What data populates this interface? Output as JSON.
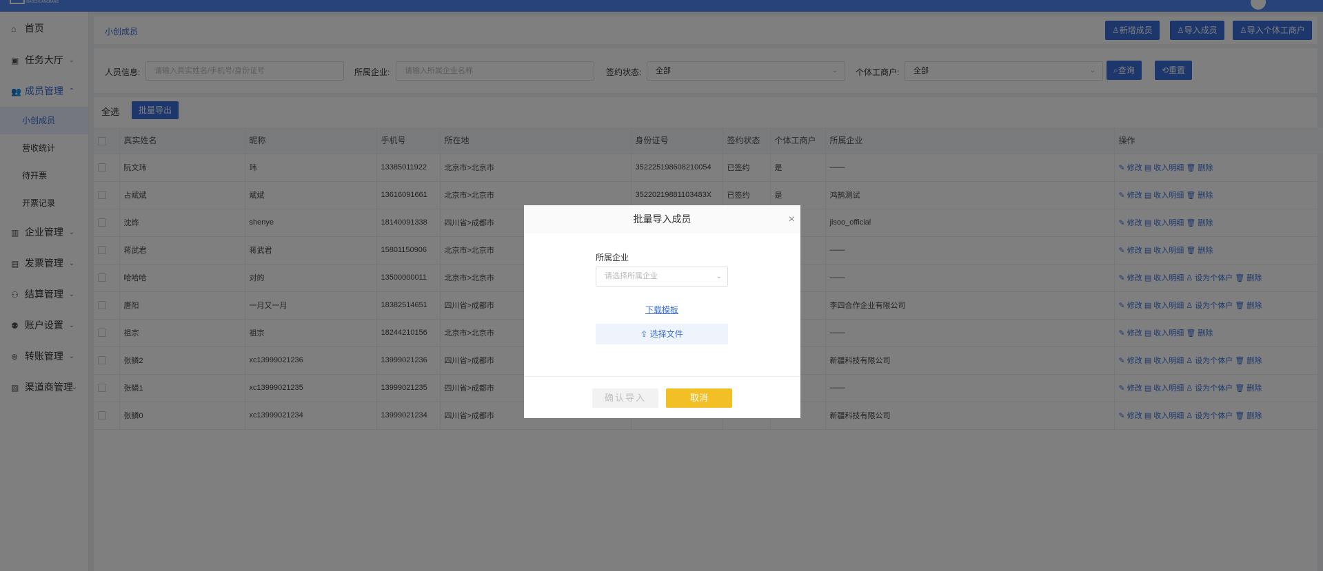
{
  "topbar": {
    "logo_sub": "XIAOCHUANGBANG",
    "avatar_icon": "user-avatar"
  },
  "sidebar": {
    "items": [
      {
        "label": "首页",
        "icon": "home-icon",
        "glyph": "⌂",
        "chev": ""
      },
      {
        "label": "任务大厅",
        "icon": "task-icon",
        "glyph": "▣",
        "chev": "⌄"
      },
      {
        "label": "成员管理",
        "icon": "members-icon",
        "glyph": "👥",
        "chev": "⌃"
      },
      {
        "label": "企业管理",
        "icon": "company-icon",
        "glyph": "▥",
        "chev": "⌄"
      },
      {
        "label": "发票管理",
        "icon": "invoice-icon",
        "glyph": "▤",
        "chev": "⌄"
      },
      {
        "label": "结算管理",
        "icon": "settlement-icon",
        "glyph": "⚇",
        "chev": "⌄"
      },
      {
        "label": "账户设置",
        "icon": "account-icon",
        "glyph": "⚉",
        "chev": "⌄"
      },
      {
        "label": "转账管理",
        "icon": "transfer-icon",
        "glyph": "⊛",
        "chev": "⌄"
      },
      {
        "label": "渠道商管理",
        "icon": "channel-icon",
        "glyph": "▧",
        "chev": "⌄"
      }
    ],
    "sub_items": [
      {
        "label": "小创成员"
      },
      {
        "label": "营收统计"
      },
      {
        "label": "待开票"
      },
      {
        "label": "开票记录"
      }
    ]
  },
  "header": {
    "breadcrumb": "小创成员",
    "btn_add": "♙新增成员",
    "btn_import": "♙导入成员",
    "btn_import_biz": "♙导入个体工商户"
  },
  "filters": {
    "person_label": "人员信息:",
    "person_placeholder": "请输入真实姓名/手机号/身份证号",
    "company_label": "所属企业:",
    "company_placeholder": "请输入所属企业名称",
    "sign_label": "签约状态:",
    "sign_value": "全部",
    "biz_label": "个体工商户:",
    "biz_value": "全部",
    "query_btn": "⌕查询",
    "reset_btn": "⟲重置"
  },
  "table": {
    "select_all": "全选",
    "batch_export": "批量导出",
    "headers": [
      "",
      "真实姓名",
      "昵称",
      "手机号",
      "所在地",
      "身份证号",
      "签约状态",
      "个体工商户",
      "所属企业",
      "操作"
    ],
    "rows": [
      [
        "",
        "阮文玮",
        "玮",
        "13385011922",
        "北京市>北京市",
        "352225198608210054",
        "已签约",
        "是",
        "——",
        "✎ 修改  ▤ 收入明细  🗑 删除"
      ],
      [
        "",
        "占斌斌",
        "斌斌",
        "13616091661",
        "北京市>北京市",
        "35220219881103483X",
        "已签约",
        "是",
        "鸿鹄测试",
        "✎ 修改  ▤ 收入明细  🗑 删除"
      ],
      [
        "",
        "沈烨",
        "shenye",
        "18140091338",
        "四川省>成都市",
        "",
        "",
        "",
        "jisoo_official",
        "✎ 修改  ▤ 收入明细  🗑 删除"
      ],
      [
        "",
        "蒋武君",
        "蒋武君",
        "15801150906",
        "北京市>北京市",
        "",
        "",
        "",
        "——",
        "✎ 修改  ▤ 收入明细  🗑 删除"
      ],
      [
        "",
        "哈哈哈",
        "对的",
        "13500000011",
        "北京市>北京市",
        "",
        "",
        "",
        "——",
        "✎ 修改  ▤ 收入明细  ♙ 设为个体户  🗑 删除"
      ],
      [
        "",
        "唐阳",
        "一月又一月",
        "18382514651",
        "四川省>成都市",
        "",
        "",
        "",
        "李四合作企业有限公司",
        "✎ 修改  ▤ 收入明细  ♙ 设为个体户  🗑 删除"
      ],
      [
        "",
        "祖宗",
        "祖宗",
        "18244210156",
        "北京市>北京市",
        "",
        "",
        "",
        "——",
        "✎ 修改  ▤ 收入明细  🗑 删除"
      ],
      [
        "",
        "张鳞2",
        "xc13999021236",
        "13999021236",
        "四川省>成都市",
        "",
        "",
        "",
        "新疆科技有限公司",
        "✎ 修改  ▤ 收入明细  ♙ 设为个体户  🗑 删除"
      ],
      [
        "",
        "张鳞1",
        "xc13999021235",
        "13999021235",
        "四川省>成都市",
        "",
        "",
        "",
        "——",
        "✎ 修改  ▤ 收入明细  ♙ 设为个体户  🗑 删除"
      ],
      [
        "",
        "张鳞0",
        "xc13999021234",
        "13999021234",
        "四川省>成都市",
        "",
        "",
        "",
        "新疆科技有限公司",
        "✎ 修改  ▤ 收入明细  ♙ 设为个体户  🗑 删除"
      ]
    ]
  },
  "modal": {
    "title": "批量导入成员",
    "close": "×",
    "company_label": "所属企业",
    "company_placeholder": "请选择所属企业",
    "download_template": "下载模板",
    "choose_file": "⇪ 选择文件",
    "confirm": "确认导入",
    "cancel": "取消"
  }
}
